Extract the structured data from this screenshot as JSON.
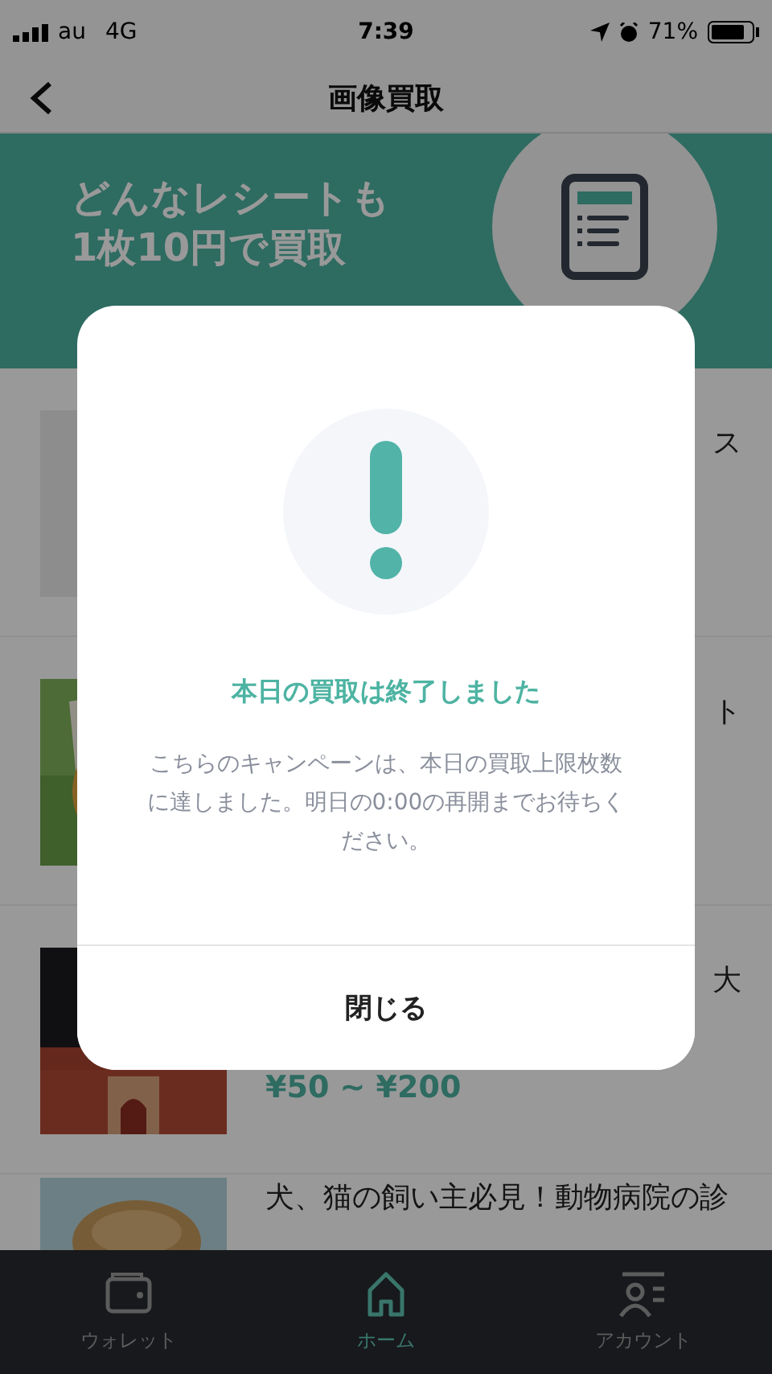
{
  "status_bar": {
    "carrier": "au",
    "network": "4G",
    "time": "7:39",
    "battery": "71%"
  },
  "header": {
    "title": "画像買取"
  },
  "banner": {
    "lines": [
      "どんなレシートも",
      "1枚10円で買取"
    ]
  },
  "list": [
    {
      "title": "ス"
    },
    {
      "title": "ト"
    },
    {
      "title": "大",
      "price": "¥50 ~ ¥200"
    },
    {
      "title": "犬、猫の飼い主必見！動物病院の診"
    }
  ],
  "dialog": {
    "title": "本日の買取は終了しました",
    "message": "こちらのキャンペーンは、本日の買取上限枚数に達しました。明日の0:00の再開までお待ちください。",
    "close_button": "閉じる"
  },
  "tab_bar": [
    {
      "label": "ウォレット",
      "selected": false
    },
    {
      "label": "ホーム",
      "selected": true
    },
    {
      "label": "アカウント",
      "selected": false
    }
  ]
}
